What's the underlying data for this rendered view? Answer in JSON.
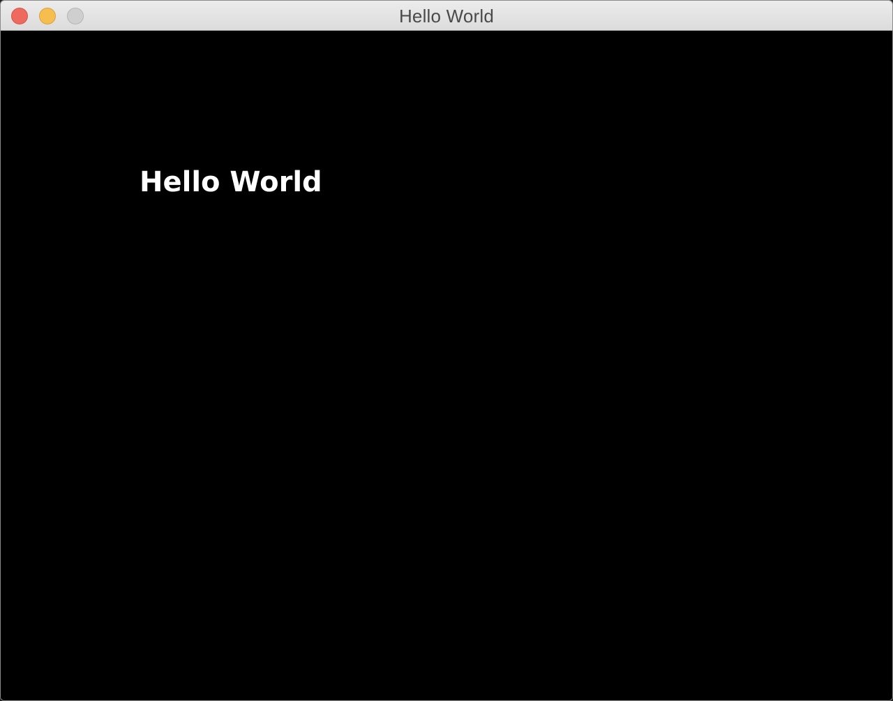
{
  "window": {
    "title": "Hello World",
    "controls": {
      "close_color": "#ee6a5e",
      "minimize_color": "#f5be4f",
      "zoom_color": "#cfcfcf"
    }
  },
  "canvas": {
    "background": "#000000",
    "text": "Hello World",
    "text_color": "#ffffff"
  }
}
